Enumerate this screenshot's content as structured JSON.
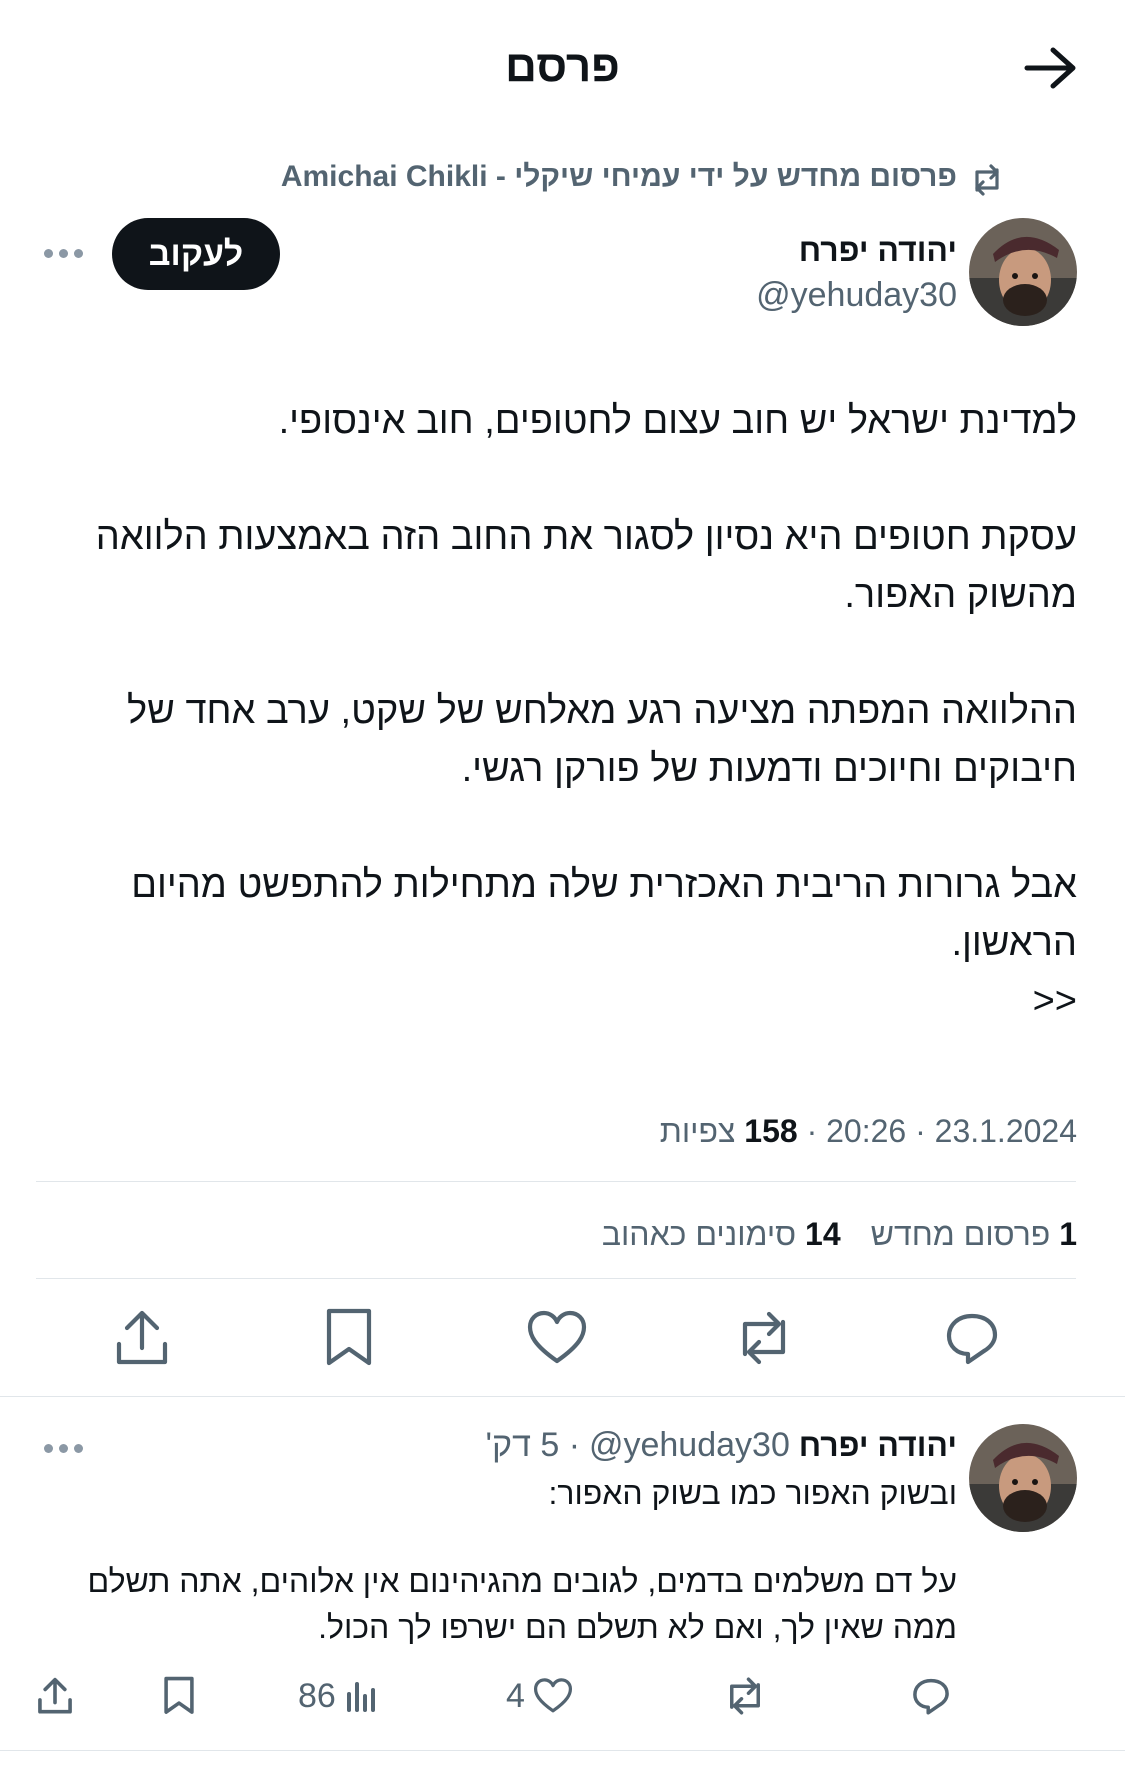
{
  "header": {
    "title": "פרסם",
    "back_icon": "arrow-right-icon"
  },
  "repost_context": {
    "text": "פרסום מחדש על ידי עמיחי שיקלי - Amichai Chikli",
    "icon": "repost-icon"
  },
  "tweet": {
    "author_name": "יהודה יפרח",
    "author_handle": "@yehuday30",
    "follow_label": "לעקוב",
    "paragraphs": [
      "למדינת ישראל יש חוב עצום לחטופים, חוב אינסופי.",
      "עסקת חטופים היא נסיון לסגור את החוב הזה באמצעות הלוואה מהשוק האפור.",
      "ההלוואה המפתה מציעה רגע מאלחש של שקט, ערב אחד של חיבוקים וחיוכים ודמעות של פורקן רגשי.",
      "אבל גרורות הריבית האכזרית שלה מתחילות להתפשט מהיום הראשון.",
      ">>"
    ],
    "date": "23.1.2024",
    "time": "20:26",
    "views_count": "158",
    "views_label": "צפיות",
    "reposts_count": "1",
    "reposts_label": "פרסום מחדש",
    "likes_count": "14",
    "likes_label": "סימונים כאהוב",
    "actions": {
      "reply": "reply-icon",
      "repost": "repost-icon",
      "like": "heart-icon",
      "bookmark": "bookmark-icon",
      "share": "share-icon"
    }
  },
  "reply": {
    "author_name": "יהודה יפרח",
    "author_handle": "@yehuday30",
    "time": "5 דק'",
    "paragraphs": [
      "ובשוק האפור כמו בשוק האפור:",
      "על דם משלמים בדמים, לגובים מהגיהינום אין אלוהים, אתה תשלם ממה שאין לך, ואם לא תשלם הם ישרפו לך הכול."
    ],
    "like_count": "4",
    "views_count": "86"
  },
  "colors": {
    "text": "#0f1419",
    "secondary": "#536471",
    "divider": "#e1e6ea",
    "follow_bg": "#0f1419"
  }
}
